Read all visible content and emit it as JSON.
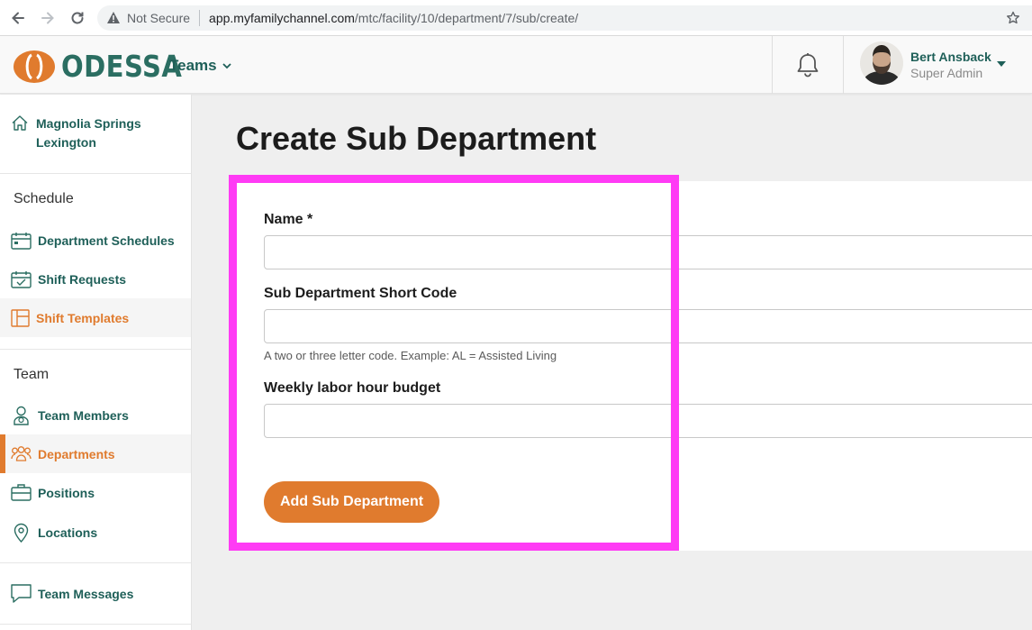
{
  "browser": {
    "security_label": "Not Secure",
    "url_host": "app.myfamilychannel.com",
    "url_path": "/mtc/facility/10/department/7/sub/create/"
  },
  "header": {
    "logo_text": "ODESSA",
    "teams_menu": "Teams",
    "user_name": "Bert Ansback",
    "user_role": "Super Admin",
    "brand_color": "#2b6e62",
    "accent_color": "#e07b2e"
  },
  "sidebar": {
    "facility": "Magnolia Springs Lexington",
    "schedule_heading": "Schedule",
    "schedule_items": [
      {
        "label": "Department Schedules",
        "icon": "calendar-icon"
      },
      {
        "label": "Shift Requests",
        "icon": "calendar-check-icon"
      },
      {
        "label": "Shift Templates",
        "icon": "template-icon"
      }
    ],
    "team_heading": "Team",
    "team_items": [
      {
        "label": "Team Members",
        "icon": "person-icon"
      },
      {
        "label": "Departments",
        "icon": "group-icon"
      },
      {
        "label": "Positions",
        "icon": "briefcase-icon"
      },
      {
        "label": "Locations",
        "icon": "map-pin-icon"
      }
    ],
    "messages_item": {
      "label": "Team Messages",
      "icon": "chat-icon"
    }
  },
  "main": {
    "title": "Create Sub Department",
    "form": {
      "name_label": "Name *",
      "name_value": "",
      "short_code_label": "Sub Department Short Code",
      "short_code_value": "",
      "short_code_help": "A two or three letter code. Example: AL = Assisted Living",
      "budget_label": "Weekly labor hour budget",
      "budget_value": "",
      "submit_label": "Add Sub Department"
    }
  }
}
